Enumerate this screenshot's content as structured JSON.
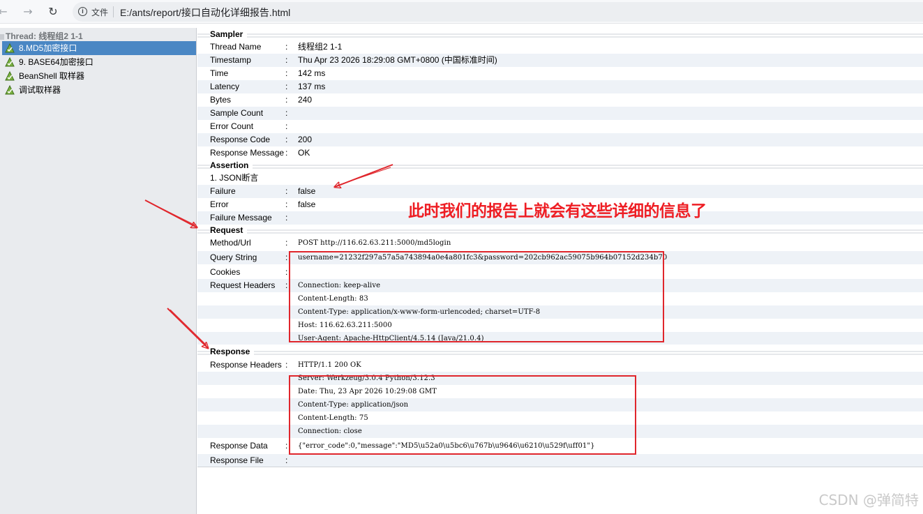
{
  "browser": {
    "file_label": "文件",
    "url": "E:/ants/report/接口自动化详细报告.html"
  },
  "tree": {
    "root_label": "Thread: 线程组2 1-1",
    "items": [
      {
        "label": "8.MD5加密接口",
        "selected": true
      },
      {
        "label": "9. BASE64加密接口",
        "selected": false
      },
      {
        "label": "BeanShell 取样器",
        "selected": false
      },
      {
        "label": "调试取样器",
        "selected": false
      }
    ]
  },
  "report": {
    "sampler": {
      "title": "Sampler",
      "rows": [
        {
          "label": "Thread Name",
          "value": "线程组2 1-1"
        },
        {
          "label": "Timestamp",
          "value": "Thu Apr 23 2026 18:29:08 GMT+0800 (中国标准时间)"
        },
        {
          "label": "Time",
          "value": "142 ms"
        },
        {
          "label": "Latency",
          "value": "137 ms"
        },
        {
          "label": "Bytes",
          "value": "240"
        },
        {
          "label": "Sample Count",
          "value": ""
        },
        {
          "label": "Error Count",
          "value": ""
        },
        {
          "label": "Response Code",
          "value": "200"
        },
        {
          "label": "Response Message",
          "value": "OK"
        }
      ]
    },
    "assertion": {
      "title": "Assertion",
      "name": "1. JSON断言",
      "rows": [
        {
          "label": "Failure",
          "value": "false"
        },
        {
          "label": "Error",
          "value": "false"
        },
        {
          "label": "Failure Message",
          "value": ""
        }
      ]
    },
    "request": {
      "title": "Request",
      "method_url_label": "Method/Url",
      "method_url": "POST http://116.62.63.211:5000/md5login",
      "query_string_label": "Query String",
      "query_string": "username=21232f297a57a5a743894a0e4a801fc3&password=202cb962ac59075b964b07152d234b70",
      "cookies_label": "Cookies",
      "cookies": "",
      "headers_label": "Request Headers",
      "headers": [
        "",
        "Connection: keep-alive",
        "Content-Length: 83",
        "Content-Type: application/x-www-form-urlencoded; charset=UTF-8",
        "Host: 116.62.63.211:5000",
        "User-Agent: Apache-HttpClient/4.5.14 (Java/21.0.4)"
      ]
    },
    "response": {
      "title": "Response",
      "headers_label": "Response Headers",
      "headers": [
        "HTTP/1.1 200 OK",
        "Server: Werkzeug/3.0.4 Python/3.12.3",
        "Date: Thu, 23 Apr 2026 10:29:08 GMT",
        "Content-Type: application/json",
        "Content-Length: 75",
        "Connection: close"
      ],
      "data_label": "Response Data",
      "data": "{\"error_code\":0,\"message\":\"MD5\\u52a0\\u5bc6\\u767b\\u9646\\u6210\\u529f\\uff01\"}",
      "file_label": "Response File",
      "file": ""
    }
  },
  "annotation": {
    "text": "此时我们的报告上就会有这些详细的信息了",
    "color": "#ee1e24"
  },
  "watermark": "CSDN @弹简特"
}
